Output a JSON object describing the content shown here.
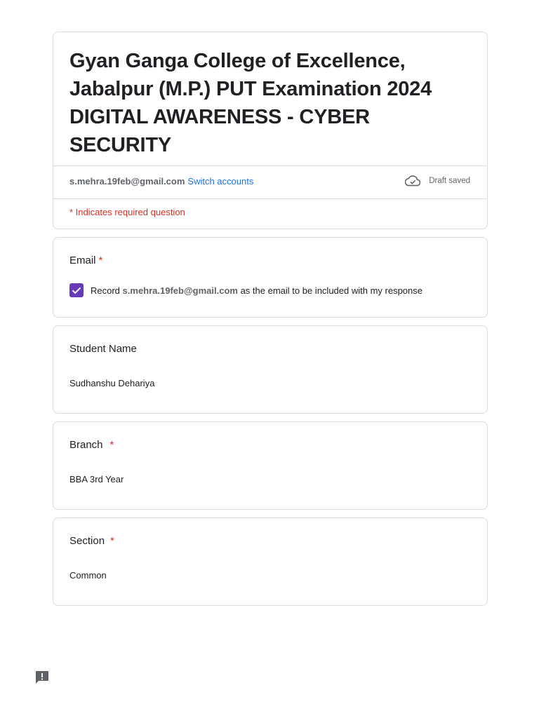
{
  "form": {
    "title": "Gyan Ganga College of Excellence, Jabalpur (M.P.) PUT Examination 2024 DIGITAL AWARENESS - CYBER SECURITY",
    "account_email": "s.mehra.19feb@gmail.com",
    "switch_accounts_label": "Switch accounts",
    "draft_status": "Draft saved",
    "required_note": "* Indicates required question"
  },
  "questions": {
    "email": {
      "label": "Email",
      "required_mark": "*",
      "checkbox_prefix": "Record",
      "checkbox_email": "s.mehra.19feb@gmail.com",
      "checkbox_suffix": "as the email to be included with my response",
      "checked": true
    },
    "student_name": {
      "label": "Student Name",
      "answer": "Sudhanshu Dehariya"
    },
    "branch": {
      "label": "Branch",
      "required_mark": "*",
      "answer": "BBA 3rd Year"
    },
    "section": {
      "label": "Section",
      "required_mark": "*",
      "answer": "Common"
    }
  },
  "icons": {
    "draft": "cloud-check-icon",
    "checkbox": "check-icon",
    "feedback": "report-issue-icon"
  },
  "colors": {
    "accent": "#673ab7",
    "link": "#1a73e8",
    "required": "#d93025",
    "border": "#dadce0"
  }
}
